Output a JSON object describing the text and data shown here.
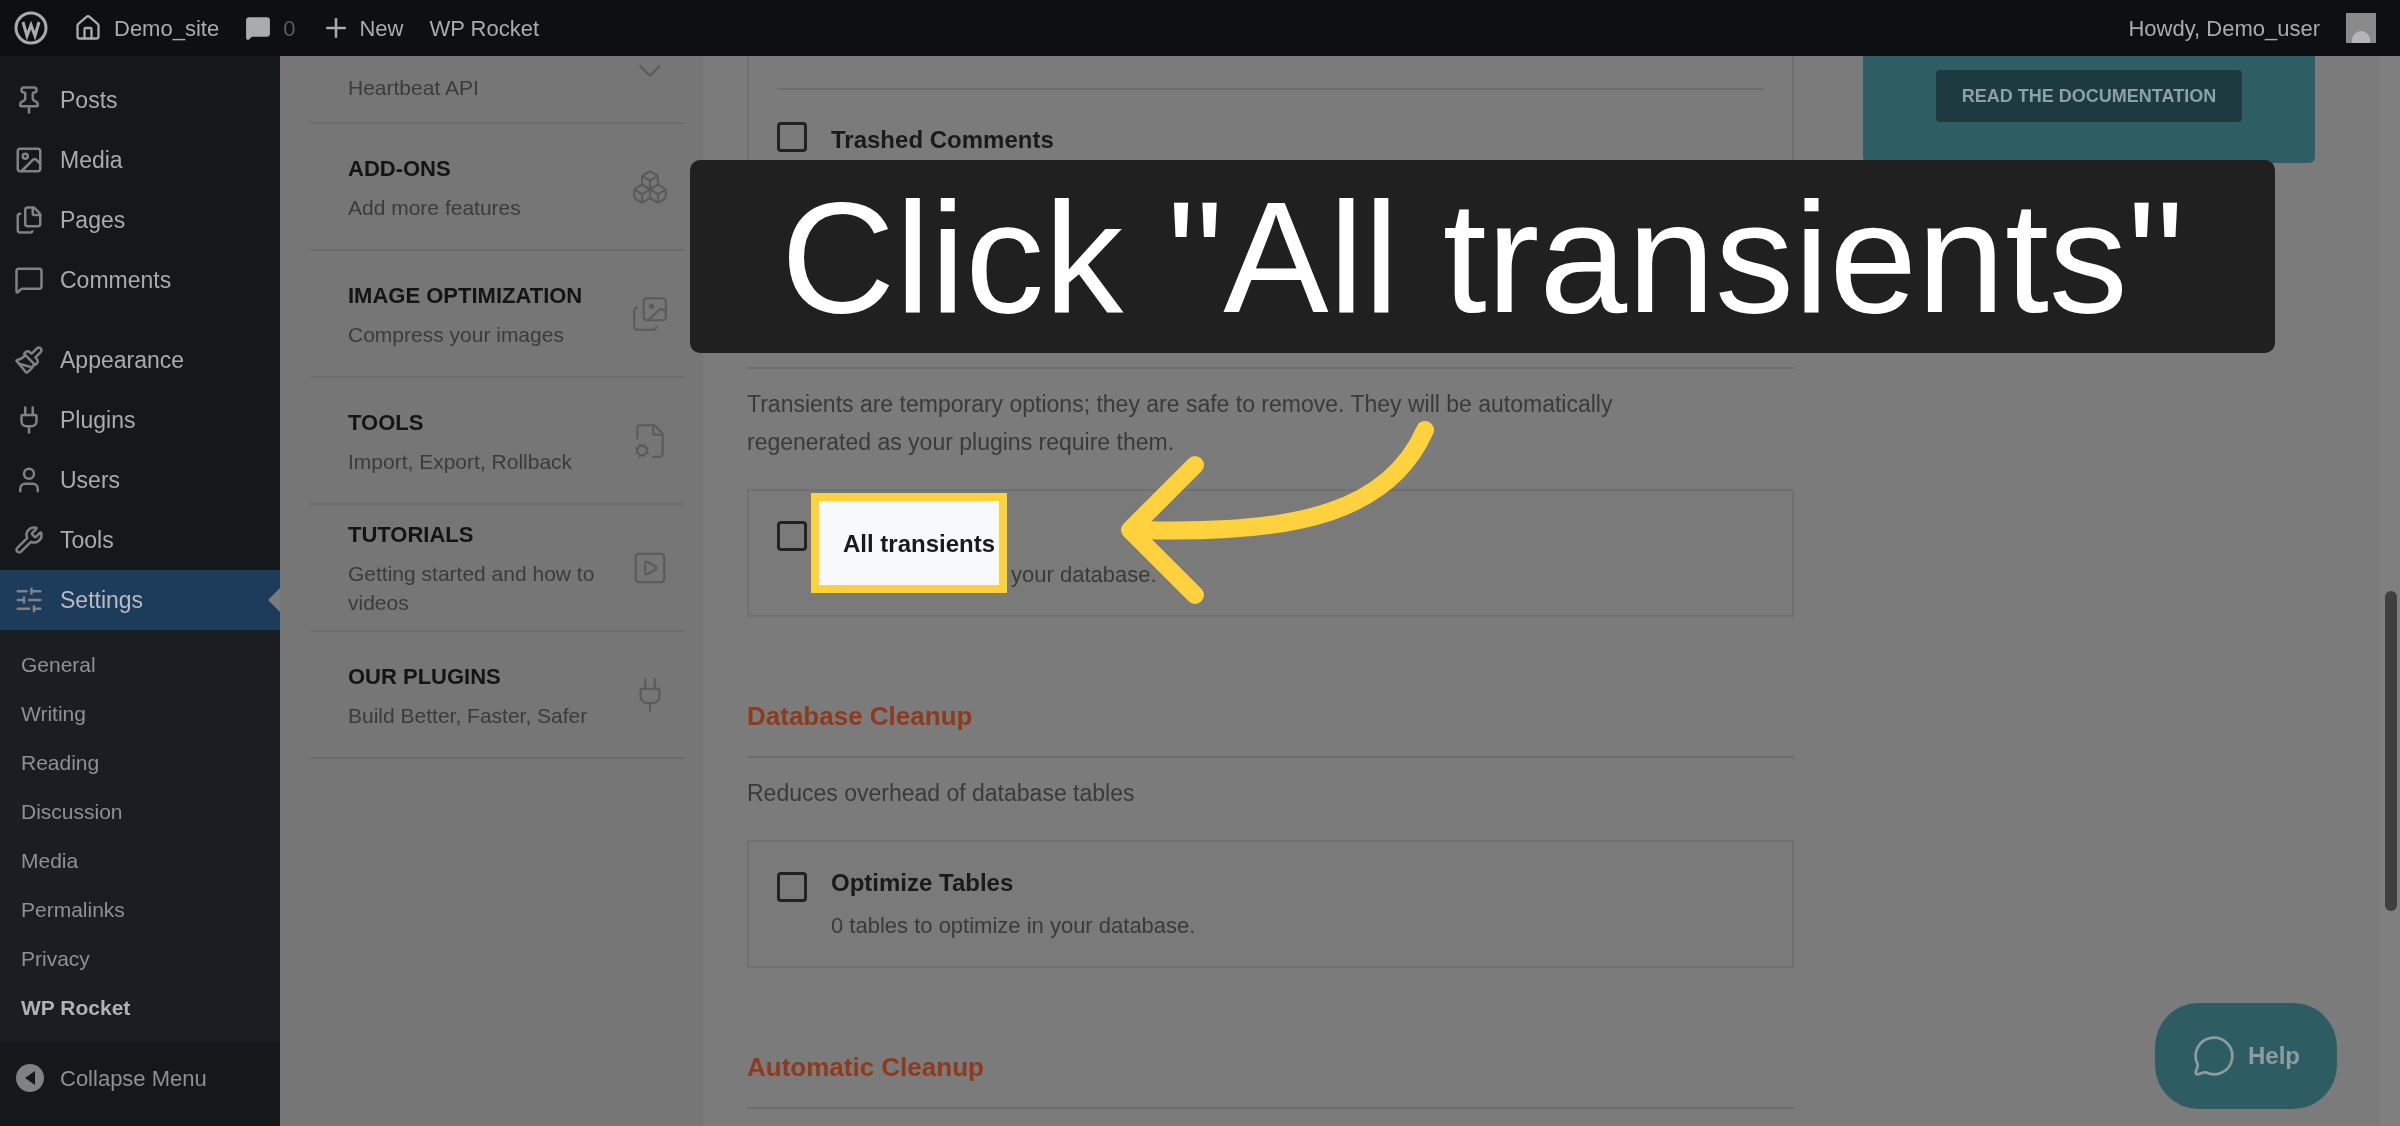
{
  "admin_bar": {
    "site": "Demo_site",
    "comments": "0",
    "new": "New",
    "plugin": "WP Rocket",
    "greeting": "Howdy, Demo_user"
  },
  "sidebar": {
    "items": [
      {
        "label": "Posts",
        "selected": false
      },
      {
        "label": "Media",
        "selected": false
      },
      {
        "label": "Pages",
        "selected": false
      },
      {
        "label": "Comments",
        "selected": false
      },
      {
        "label": "Appearance",
        "selected": false
      },
      {
        "label": "Plugins",
        "selected": false
      },
      {
        "label": "Users",
        "selected": false
      },
      {
        "label": "Tools",
        "selected": false
      },
      {
        "label": "Settings",
        "selected": true
      }
    ],
    "submenu": [
      {
        "label": "General",
        "selected": false
      },
      {
        "label": "Writing",
        "selected": false
      },
      {
        "label": "Reading",
        "selected": false
      },
      {
        "label": "Discussion",
        "selected": false
      },
      {
        "label": "Media",
        "selected": false
      },
      {
        "label": "Permalinks",
        "selected": false
      },
      {
        "label": "Privacy",
        "selected": false
      },
      {
        "label": "WP Rocket",
        "selected": true
      }
    ],
    "collapse": "Collapse Menu"
  },
  "rocket_nav": [
    {
      "description": "Heartbeat API"
    },
    {
      "title": "ADD-ONS",
      "description": "Add more features"
    },
    {
      "title": "IMAGE OPTIMIZATION",
      "description": "Compress your images"
    },
    {
      "title": "TOOLS",
      "description": "Import, Export, Rollback"
    },
    {
      "title": "TUTORIALS",
      "description": "Getting started and how to videos"
    },
    {
      "title": "OUR PLUGINS",
      "description": "Build Better, Faster, Safer"
    }
  ],
  "content": {
    "top_options": [
      {
        "label": "Trashed Comments",
        "checked": false
      }
    ],
    "sections": [
      {
        "text": "Transients are temporary options; they are safe to remove. They will be automatically regenerated as your plugins require them.",
        "options": [
          {
            "label": "All transients",
            "description": "your database.",
            "checked": false,
            "highlighted": true
          }
        ]
      },
      {
        "heading": "Database Cleanup",
        "text": "Reduces overhead of database tables",
        "options": [
          {
            "label": "Optimize Tables",
            "description": "0 tables to optimize in your database.",
            "checked": false,
            "highlighted": false
          }
        ]
      },
      {
        "heading": "Automatic Cleanup"
      }
    ]
  },
  "doc_button": "READ THE DOCUMENTATION",
  "help_button": "Help",
  "callout": "Click \"All transients\""
}
